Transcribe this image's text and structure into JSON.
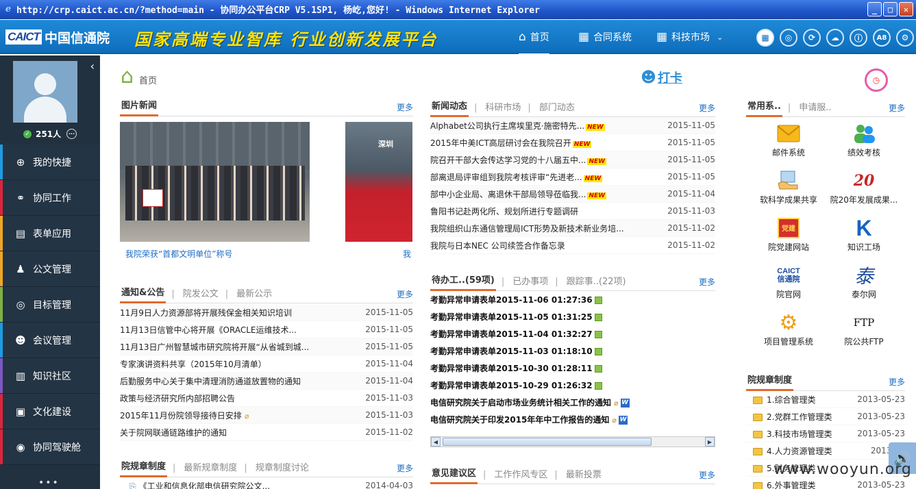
{
  "window": {
    "title": "http://crp.caict.ac.cn/?method=main - 协同办公平台CRP V5.1SP1, 杨屹,您好! - Windows Internet Explorer",
    "ie_icon": "e"
  },
  "header": {
    "logo_en": "CAICT",
    "logo_cn": "中国信通院",
    "slogan": "国家高端专业智库 行业创新发展平台",
    "nav": [
      {
        "label": "首页",
        "icon": "⌂"
      },
      {
        "label": "合同系统",
        "icon": "▦"
      },
      {
        "label": "科技市场",
        "icon": "▦"
      }
    ],
    "tool_icons": [
      "▦",
      "◎",
      "⟳",
      "☁",
      "ⓘ",
      "A8",
      "⚙"
    ]
  },
  "sidebar": {
    "online_count": "251人",
    "menu": [
      {
        "label": "我的快捷",
        "icon": "⊕",
        "color": "#1e9be0"
      },
      {
        "label": "协同工作",
        "icon": "⚭",
        "color": "#d9263b"
      },
      {
        "label": "表单应用",
        "icon": "▤",
        "color": "#f0a623"
      },
      {
        "label": "公文管理",
        "icon": "♟",
        "color": "#f0a623"
      },
      {
        "label": "目标管理",
        "icon": "◎",
        "color": "#7cb342"
      },
      {
        "label": "会议管理",
        "icon": "☻",
        "color": "#1e9be0"
      },
      {
        "label": "知识社区",
        "icon": "▥",
        "color": "#7e57c2"
      },
      {
        "label": "文化建设",
        "icon": "▣",
        "color": "#d9263b"
      },
      {
        "label": "协同驾驶舱",
        "icon": "◉",
        "color": "#d9263b"
      }
    ],
    "more": "•••"
  },
  "breadcrumb": "首页",
  "punch": "打卡",
  "photo_news": {
    "title": "图片新闻",
    "more": "更多",
    "caption1": "我院荣获“首都文明单位”称号",
    "caption2": "我",
    "photo2_label": "深圳"
  },
  "notices": {
    "tabs": [
      "通知&公告",
      "院发公文",
      "最新公示"
    ],
    "more": "更多",
    "rows": [
      {
        "text": "11月9日人力资源部将开展残保金相关知识培训",
        "date": "2015-11-05"
      },
      {
        "text": "11月13日信管中心将开展《ORACLE运维技术...",
        "date": "2015-11-05"
      },
      {
        "text": "11月13日广州智慧城市研究院将开展“从省城到城...",
        "date": "2015-11-05"
      },
      {
        "text": "专家演讲资料共享（2015年10月清单）",
        "date": "2015-11-04"
      },
      {
        "text": "后勤服务中心关于集中清理消防通道放置物的通知",
        "date": "2015-11-04"
      },
      {
        "text": "政策与经济研究所内部招聘公告",
        "date": "2015-11-03"
      },
      {
        "text": "2015年11月份院领导接待日安排",
        "date": "2015-11-03"
      },
      {
        "text": "关于院网联通链路维护的通知",
        "date": "2015-11-02"
      }
    ]
  },
  "rules_left": {
    "tabs": [
      "院规章制度",
      "最新规章制度",
      "规章制度讨论"
    ],
    "more": "更多",
    "rows": [
      {
        "text": "《工业和信息化部电信研究院公文...",
        "date": "2014-04-03"
      }
    ]
  },
  "news": {
    "tabs": [
      "新闻动态",
      "科研市场",
      "部门动态"
    ],
    "more": "更多",
    "new_tag": "NEW",
    "rows": [
      {
        "text": "Alphabet公司执行主席埃里克·施密特先...",
        "date": "2015-11-05",
        "new": true
      },
      {
        "text": "2015年中美ICT高层研讨会在我院召开",
        "date": "2015-11-05",
        "new": true
      },
      {
        "text": "院召开干部大会传达学习党的十八届五中...",
        "date": "2015-11-05",
        "new": true
      },
      {
        "text": "部离退局评审组到我院考核评审“先进老...",
        "date": "2015-11-05",
        "new": true
      },
      {
        "text": "部中小企业局、离退休干部局领导莅临我...",
        "date": "2015-11-04",
        "new": true
      },
      {
        "text": "鲁阳书记赴两化所、规划所进行专题调研",
        "date": "2015-11-03",
        "new": false
      },
      {
        "text": "我院组织山东通信管理局ICT形势及新技术新业务培...",
        "date": "2015-11-02",
        "new": false
      },
      {
        "text": "我院与日本NEC 公司续签合作备忘录",
        "date": "2015-11-02",
        "new": false
      }
    ]
  },
  "todo": {
    "tabs": [
      "待办工..(59项)",
      "已办事项",
      "跟踪事..(22项)"
    ],
    "more": "更多",
    "rows": [
      {
        "text": "考勤异常申请表单2015-11-06 01:27:36",
        "kind": "form"
      },
      {
        "text": "考勤异常申请表单2015-11-05 01:31:25",
        "kind": "form"
      },
      {
        "text": "考勤异常申请表单2015-11-04 01:32:27",
        "kind": "form"
      },
      {
        "text": "考勤异常申请表单2015-11-03 01:18:10",
        "kind": "form"
      },
      {
        "text": "考勤异常申请表单2015-10-30 01:28:11",
        "kind": "form"
      },
      {
        "text": "考勤异常申请表单2015-10-29 01:26:32",
        "kind": "form"
      },
      {
        "text": "电信研究院关于启动市场业务统计相关工作的通知",
        "kind": "doc"
      },
      {
        "text": "电信研究院关于印发2015年年中工作报告的通知",
        "kind": "doc"
      }
    ],
    "doc_badge": "W"
  },
  "opinion": {
    "tabs": [
      "意见建议区",
      "工作作风专区",
      "最新投票"
    ],
    "more": "更多"
  },
  "systems": {
    "tabs": [
      "常用系..",
      "申请服.."
    ],
    "more": "更多",
    "items": [
      {
        "label": "邮件系统",
        "icon": "mail-icon"
      },
      {
        "label": "绩效考核",
        "icon": "people-icon"
      },
      {
        "label": "软科学成果共享",
        "icon": "share-icon"
      },
      {
        "label": "院20年发展成果...",
        "icon": "anniversary-icon"
      },
      {
        "label": "院党建网站",
        "icon": "party-icon"
      },
      {
        "label": "知识工场",
        "icon": "k-icon"
      },
      {
        "label": "院官网",
        "icon": "caict-icon"
      },
      {
        "label": "泰尔网",
        "icon": "tai-icon"
      },
      {
        "label": "项目管理系统",
        "icon": "gear-icon"
      },
      {
        "label": "院公共FTP",
        "icon": "ftp-icon"
      }
    ],
    "k_glyph": "K",
    "tai_glyph": "泰",
    "ftp_glyph": "FTP",
    "caict_glyph": "CAICT",
    "caict_sub": "信通院",
    "party_glyph": "党建",
    "anniv_glyph": "20"
  },
  "rules_right": {
    "tabs": [
      "院规章制度"
    ],
    "more": "更多",
    "rows": [
      {
        "text": "1.综合管理类",
        "date": "2013-05-23"
      },
      {
        "text": "2.党群工作管理类",
        "date": "2013-05-23"
      },
      {
        "text": "3.科技市场管理类",
        "date": "2013-05-23"
      },
      {
        "text": "4.人力资源管理类",
        "date": "2013-05"
      },
      {
        "text": "5.财务管理类",
        "date": ""
      },
      {
        "text": "6.外事管理类",
        "date": "2013-05-23"
      }
    ]
  },
  "watermark": "www.wooyun.org"
}
